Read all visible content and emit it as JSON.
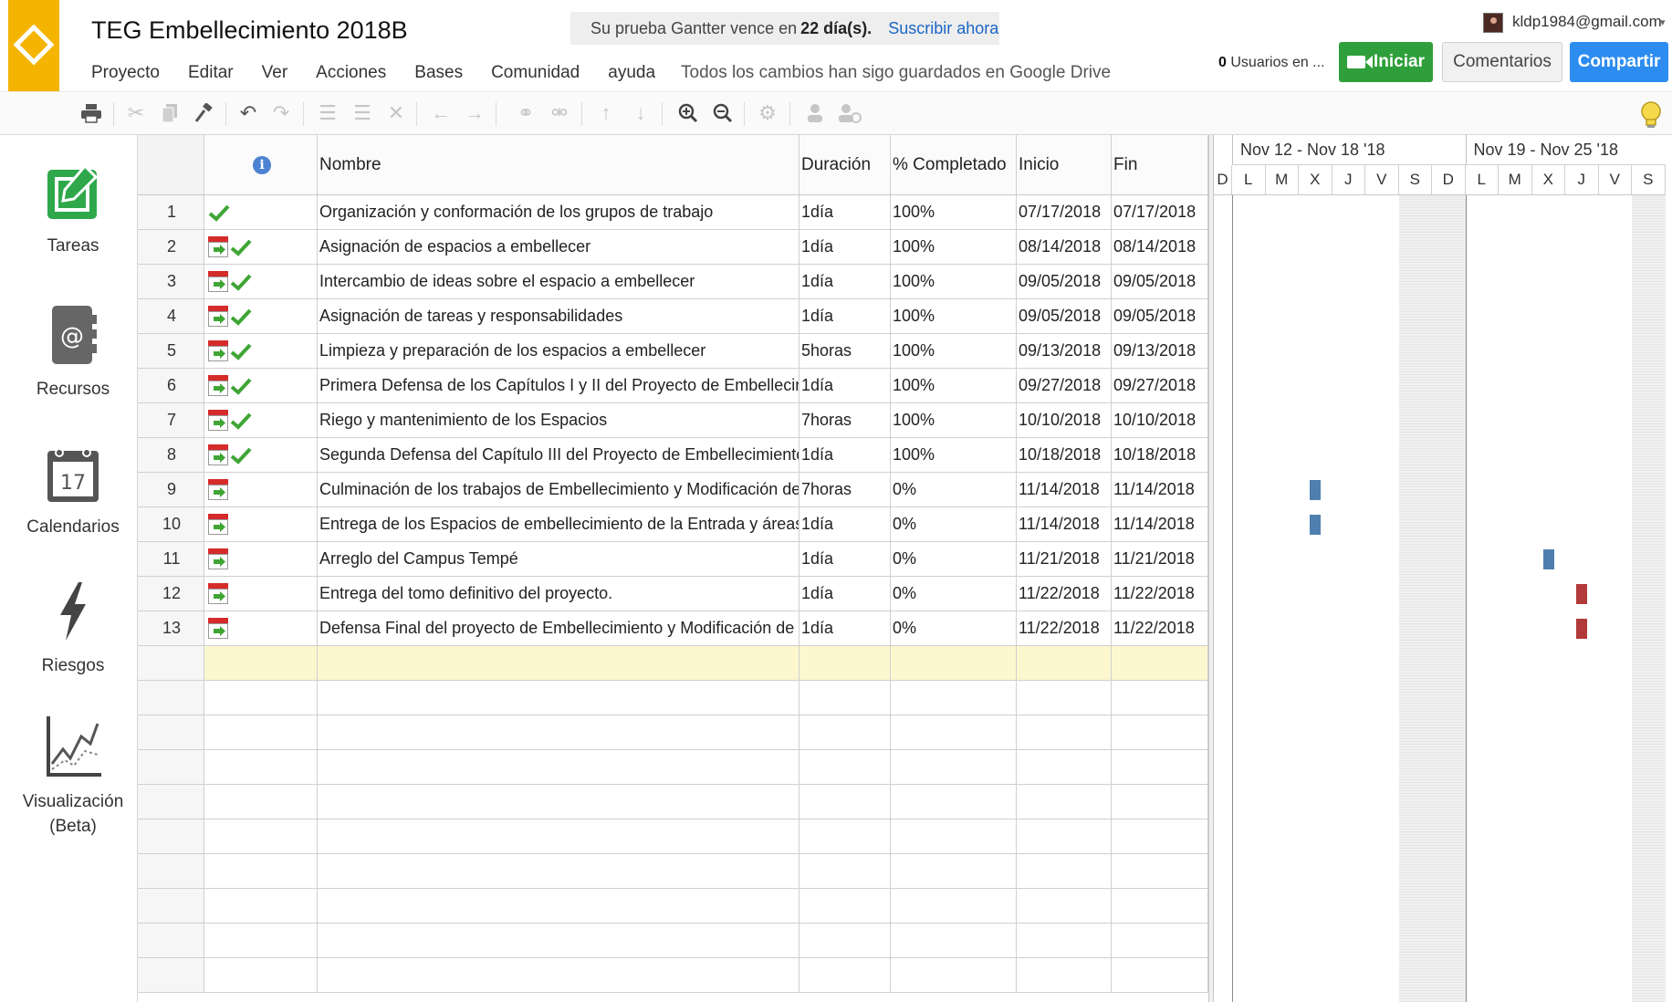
{
  "header": {
    "title": "TEG Embellecimiento 2018B",
    "menu": [
      "Proyecto",
      "Editar",
      "Ver",
      "Acciones",
      "Bases",
      "Comunidad",
      "ayuda"
    ],
    "save_status": "Todos los cambios han sigo guardados en Google Drive",
    "trial": {
      "prefix": "Su prueba Gantter vence en",
      "days": "22 día(s).",
      "link": "Suscribir ahora"
    },
    "user_email": "kldp1984@gmail.com",
    "users_online_count": "0",
    "users_online_label": "Usuarios en ...",
    "buttons": {
      "start": "Iniciar",
      "comments": "Comentarios",
      "share": "Compartir"
    }
  },
  "toolbar": {
    "icons": [
      "print-icon",
      "cut-icon",
      "copy-icon",
      "paint-format-icon",
      "undo-icon",
      "redo-icon",
      "indent-icon",
      "outdent-icon",
      "delete-icon",
      "arrow-left-icon",
      "arrow-right-icon",
      "link-icon",
      "unlink-icon",
      "arrow-up-icon",
      "arrow-down-icon",
      "zoom-in-icon",
      "zoom-out-icon",
      "settings-icon",
      "person-icon",
      "assign-resource-icon",
      "lightbulb-icon"
    ]
  },
  "sidebar": {
    "items": [
      {
        "id": "tareas",
        "label": "Tareas",
        "active": true
      },
      {
        "id": "recursos",
        "label": "Recursos"
      },
      {
        "id": "calendarios",
        "label": "Calendarios",
        "calendar_day": "17"
      },
      {
        "id": "riesgos",
        "label": "Riesgos"
      },
      {
        "id": "visualizacion",
        "label": "Visualización",
        "sublabel": "(Beta)"
      }
    ]
  },
  "grid": {
    "columns": {
      "info": "i",
      "name": "Nombre",
      "duration": "Duración",
      "percent": "% Completado",
      "start": "Inicio",
      "end": "Fin"
    },
    "rows": [
      {
        "num": "1",
        "cal": false,
        "done": true,
        "name": "Organización y conformación de los grupos de trabajo",
        "duration": "1día",
        "percent": "100%",
        "start": "07/17/2018",
        "end": "07/17/2018"
      },
      {
        "num": "2",
        "cal": true,
        "done": true,
        "name": "Asignación de espacios a embellecer",
        "duration": "1día",
        "percent": "100%",
        "start": "08/14/2018",
        "end": "08/14/2018"
      },
      {
        "num": "3",
        "cal": true,
        "done": true,
        "name": "Intercambio de ideas sobre el espacio a embellecer",
        "duration": "1día",
        "percent": "100%",
        "start": "09/05/2018",
        "end": "09/05/2018"
      },
      {
        "num": "4",
        "cal": true,
        "done": true,
        "name": "Asignación de tareas y responsabilidades",
        "duration": "1día",
        "percent": "100%",
        "start": "09/05/2018",
        "end": "09/05/2018"
      },
      {
        "num": "5",
        "cal": true,
        "done": true,
        "name": "Limpieza y preparación de los espacios a embellecer",
        "duration": "5horas",
        "percent": "100%",
        "start": "09/13/2018",
        "end": "09/13/2018"
      },
      {
        "num": "6",
        "cal": true,
        "done": true,
        "name": "Primera Defensa de los Capítulos I y II del Proyecto de Embellecin",
        "duration": "1día",
        "percent": "100%",
        "start": "09/27/2018",
        "end": "09/27/2018"
      },
      {
        "num": "7",
        "cal": true,
        "done": true,
        "name": "Riego y mantenimiento de los Espacios",
        "duration": "7horas",
        "percent": "100%",
        "start": "10/10/2018",
        "end": "10/10/2018"
      },
      {
        "num": "8",
        "cal": true,
        "done": true,
        "name": "Segunda Defensa del Capítulo III del Proyecto de Embellecimientc",
        "duration": "1día",
        "percent": "100%",
        "start": "10/18/2018",
        "end": "10/18/2018"
      },
      {
        "num": "9",
        "cal": true,
        "done": false,
        "name": "Culminación de los trabajos de Embellecimiento y Modificación de",
        "duration": "7horas",
        "percent": "0%",
        "start": "11/14/2018",
        "end": "11/14/2018"
      },
      {
        "num": "10",
        "cal": true,
        "done": false,
        "name": "Entrega de los Espacios de embellecimiento de la Entrada y áreas",
        "duration": "1día",
        "percent": "0%",
        "start": "11/14/2018",
        "end": "11/14/2018"
      },
      {
        "num": "11",
        "cal": true,
        "done": false,
        "name": "Arreglo del Campus Tempé",
        "duration": "1día",
        "percent": "0%",
        "start": "11/21/2018",
        "end": "11/21/2018"
      },
      {
        "num": "12",
        "cal": true,
        "done": false,
        "name": "Entrega del tomo definitivo del proyecto.",
        "duration": "1día",
        "percent": "0%",
        "start": "11/22/2018",
        "end": "11/22/2018"
      },
      {
        "num": "13",
        "cal": true,
        "done": false,
        "name": "Defensa Final del proyecto de Embellecimiento y Modificación  de",
        "duration": "1día",
        "percent": "0%",
        "start": "11/22/2018",
        "end": "11/22/2018"
      }
    ],
    "empty_rows": 10
  },
  "gantt": {
    "partial_prev_day": "D",
    "weeks": [
      {
        "label": "Nov 12 - Nov 18 '18",
        "days": [
          "L",
          "M",
          "X",
          "J",
          "V",
          "S",
          "D"
        ]
      },
      {
        "label": "Nov 19 - Nov 25 '18",
        "days": [
          "L",
          "M",
          "X",
          "J",
          "V",
          "S"
        ]
      }
    ],
    "bars": [
      {
        "row": 9,
        "week": 0,
        "day": 2,
        "color": "#4f7fae"
      },
      {
        "row": 10,
        "week": 0,
        "day": 2,
        "color": "#4f7fae"
      },
      {
        "row": 11,
        "week": 1,
        "day": 2,
        "color": "#4f7fae"
      },
      {
        "row": 12,
        "week": 1,
        "day": 3,
        "color": "#b23a3a"
      },
      {
        "row": 13,
        "week": 1,
        "day": 3,
        "color": "#b23a3a"
      }
    ]
  },
  "colors": {
    "brand": "#f4b400",
    "start_button": "#2f9f3b",
    "share_button": "#2d8cf0",
    "link": "#1a66c7",
    "check": "#3fa535",
    "new_row": "#fcf7cf"
  }
}
